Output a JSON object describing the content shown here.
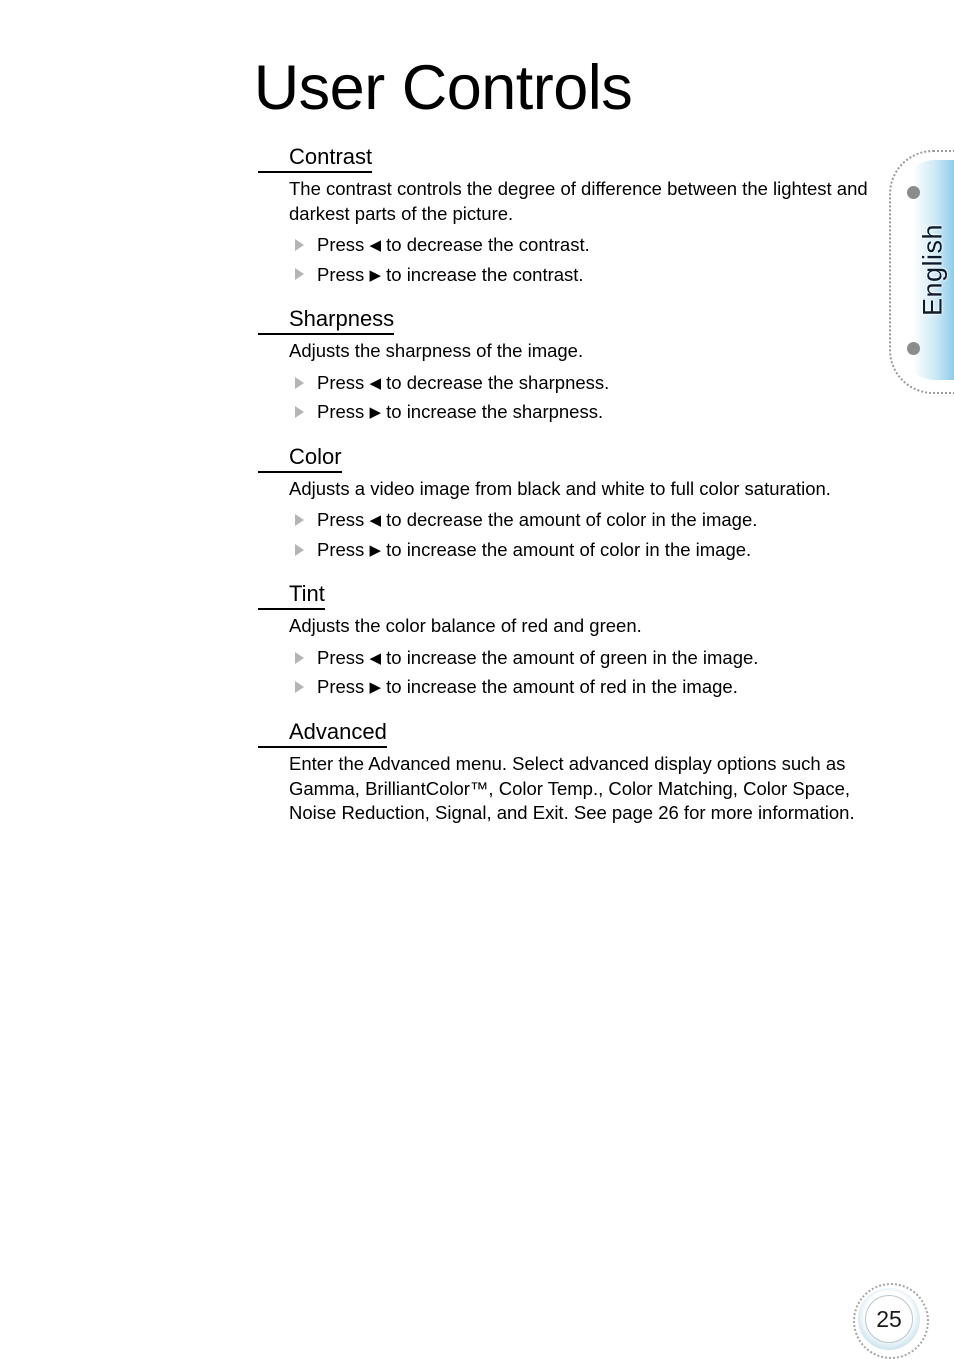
{
  "page": {
    "title": "User Controls",
    "number": "25",
    "language_tab": "English"
  },
  "sections": [
    {
      "heading": "Contrast",
      "body": "The contrast controls the degree of difference between the lightest and darkest parts of the picture.",
      "bullets": [
        {
          "prefix": "Press ",
          "arrow": "◀",
          "suffix": " to decrease the contrast."
        },
        {
          "prefix": "Press ",
          "arrow": "▶",
          "suffix": " to increase the contrast."
        }
      ]
    },
    {
      "heading": "Sharpness",
      "body": "Adjusts the sharpness of the image.",
      "bullets": [
        {
          "prefix": "Press ",
          "arrow": "◀",
          "suffix": " to decrease the sharpness."
        },
        {
          "prefix": "Press ",
          "arrow": "▶",
          "suffix": " to increase the sharpness."
        }
      ]
    },
    {
      "heading": "Color",
      "body": "Adjusts a video image from black and white to full color saturation.",
      "bullets": [
        {
          "prefix": "Press ",
          "arrow": "◀",
          "suffix": " to decrease the amount of color in the image."
        },
        {
          "prefix": "Press ",
          "arrow": "▶",
          "suffix": " to increase the amount of color in the image."
        }
      ]
    },
    {
      "heading": "Tint",
      "body": "Adjusts the color balance of red and green.",
      "bullets": [
        {
          "prefix": "Press ",
          "arrow": "◀",
          "suffix": " to increase the amount of green in the image."
        },
        {
          "prefix": "Press ",
          "arrow": "▶",
          "suffix": " to increase the amount of red in the image."
        }
      ]
    },
    {
      "heading": "Advanced",
      "body": "Enter the Advanced menu. Select advanced display options such as Gamma, BrilliantColor™, Color Temp., Color Matching, Color Space, Noise Reduction, Signal, and Exit. See page 26 for more information.",
      "bullets": []
    }
  ],
  "colors": {
    "tab_blue": "#79c2e6",
    "bullet_gray": "#b5b5b5",
    "dot_gray": "#8c8c8c"
  }
}
